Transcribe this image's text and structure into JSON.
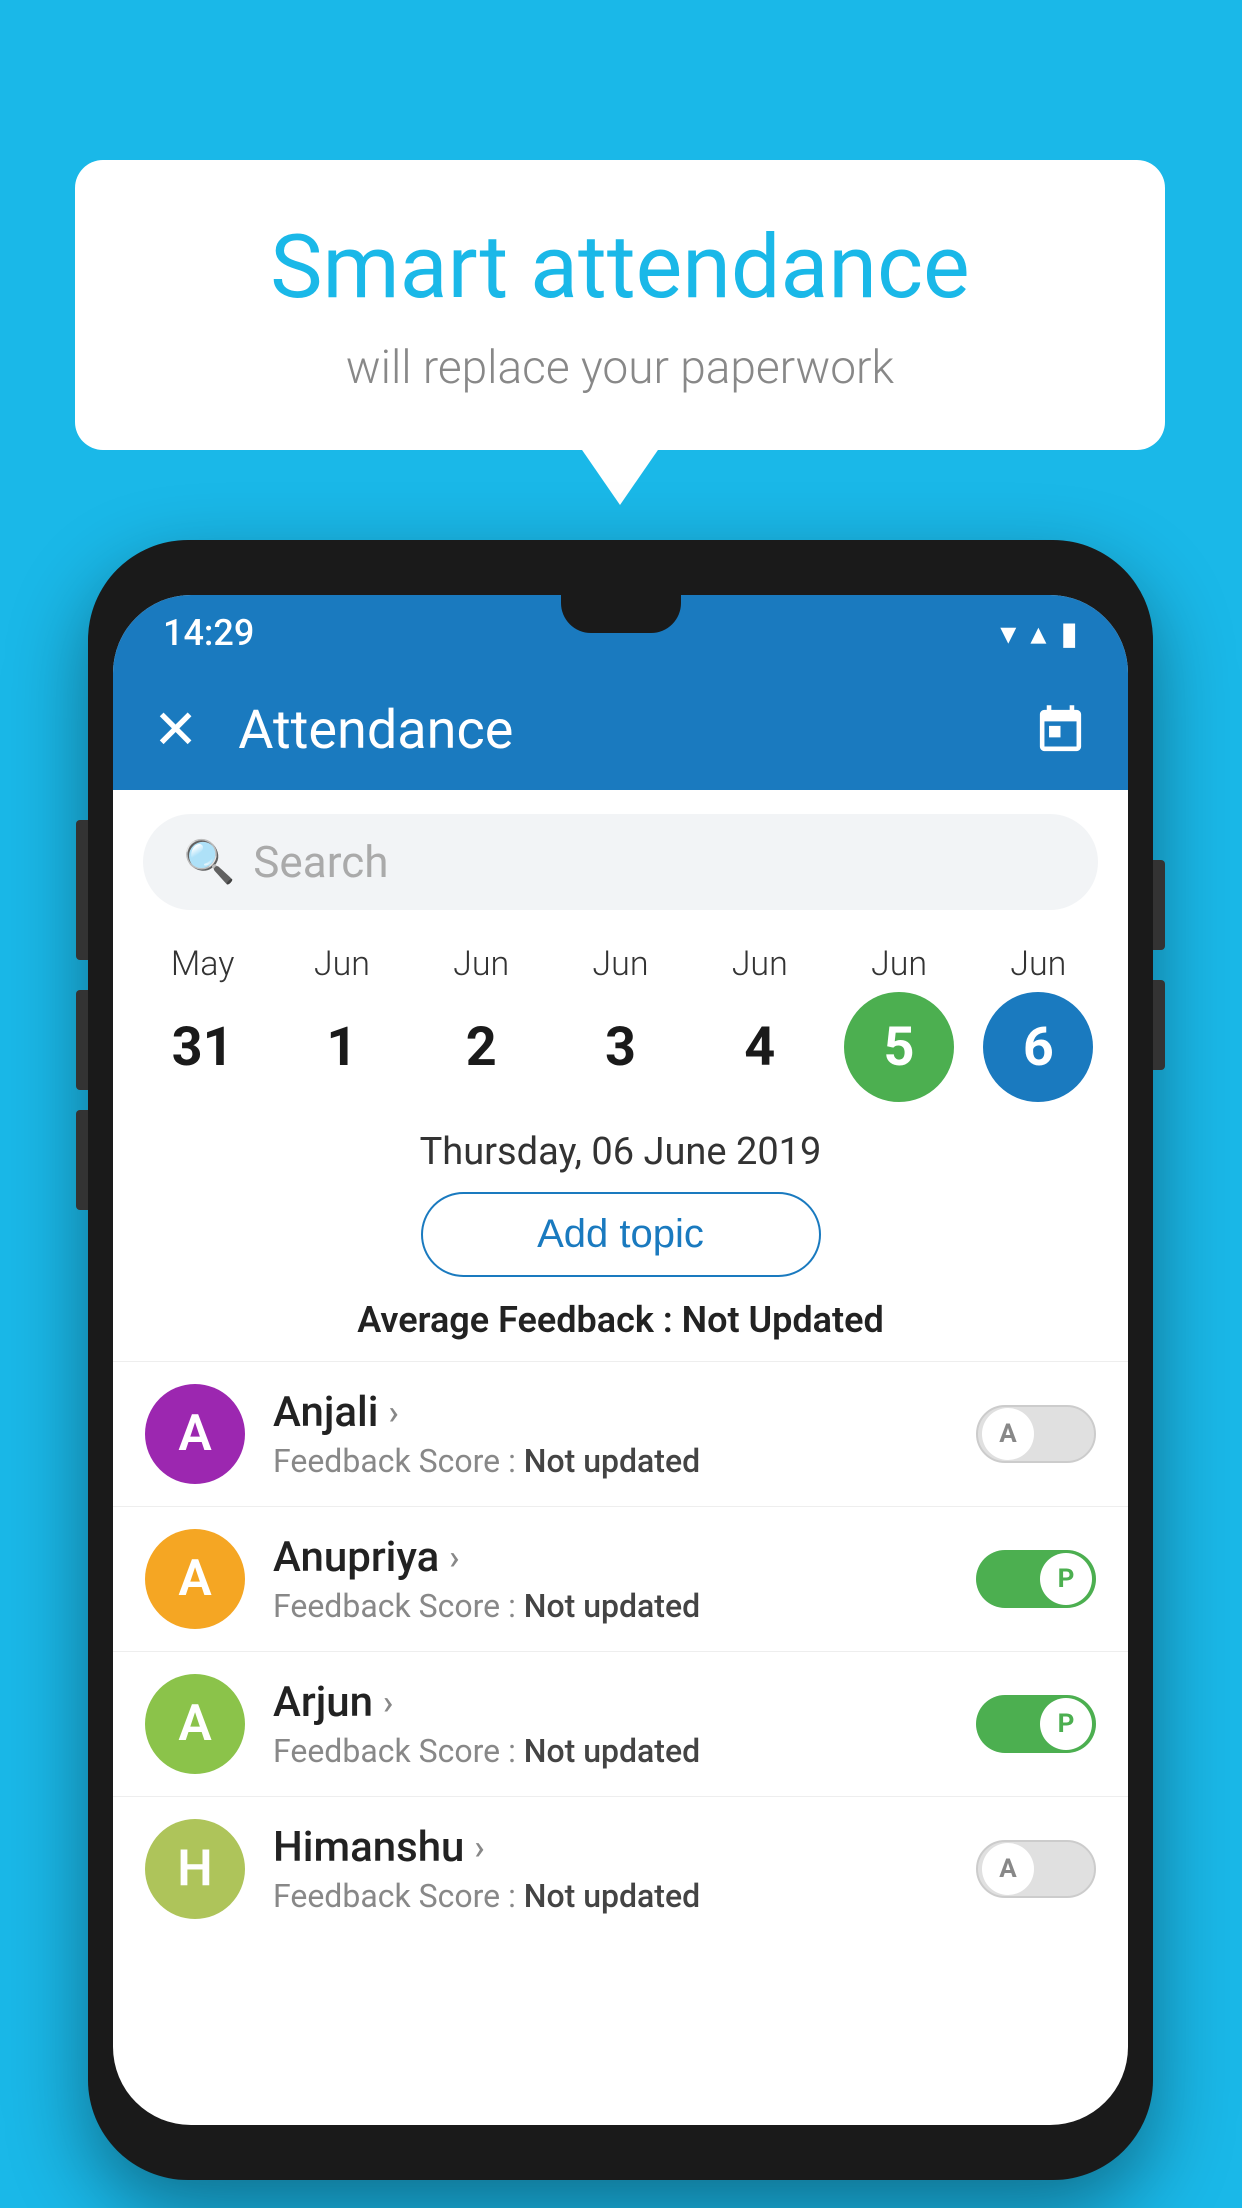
{
  "background_color": "#1ab8e8",
  "bubble": {
    "title": "Smart attendance",
    "subtitle": "will replace your paperwork"
  },
  "phone": {
    "status_bar": {
      "time": "14:29",
      "wifi_icon": "▼",
      "signal_icon": "▲",
      "battery_icon": "▮"
    },
    "app_bar": {
      "close_label": "✕",
      "title": "Attendance",
      "calendar_label": "📅"
    },
    "search": {
      "placeholder": "Search",
      "icon": "🔍"
    },
    "calendar": {
      "days": [
        {
          "month": "May",
          "day": "31",
          "style": "normal"
        },
        {
          "month": "Jun",
          "day": "1",
          "style": "normal"
        },
        {
          "month": "Jun",
          "day": "2",
          "style": "normal"
        },
        {
          "month": "Jun",
          "day": "3",
          "style": "normal"
        },
        {
          "month": "Jun",
          "day": "4",
          "style": "normal"
        },
        {
          "month": "Jun",
          "day": "5",
          "style": "today"
        },
        {
          "month": "Jun",
          "day": "6",
          "style": "selected"
        }
      ]
    },
    "selected_date": "Thursday, 06 June 2019",
    "add_topic_label": "Add topic",
    "avg_feedback_label": "Average Feedback : ",
    "avg_feedback_value": "Not Updated",
    "students": [
      {
        "name": "Anjali",
        "initial": "A",
        "avatar_color": "#9c27b0",
        "feedback_label": "Feedback Score : ",
        "feedback_value": "Not updated",
        "toggle": "off",
        "toggle_letter": "A"
      },
      {
        "name": "Anupriya",
        "initial": "A",
        "avatar_color": "#f5a623",
        "feedback_label": "Feedback Score : ",
        "feedback_value": "Not updated",
        "toggle": "on",
        "toggle_letter": "P"
      },
      {
        "name": "Arjun",
        "initial": "A",
        "avatar_color": "#8bc34a",
        "feedback_label": "Feedback Score : ",
        "feedback_value": "Not updated",
        "toggle": "on",
        "toggle_letter": "P"
      },
      {
        "name": "Himanshu",
        "initial": "H",
        "avatar_color": "#aec45a",
        "feedback_label": "Feedback Score : ",
        "feedback_value": "Not updated",
        "toggle": "off",
        "toggle_letter": "A"
      }
    ]
  }
}
